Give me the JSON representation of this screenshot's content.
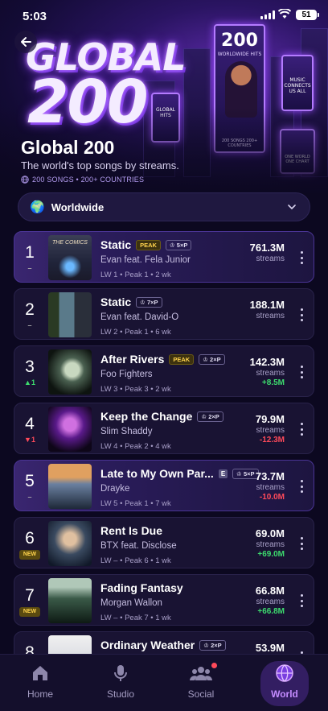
{
  "status_bar": {
    "time": "5:03",
    "battery": "51"
  },
  "hero": {
    "title_line1": "GLOBAL",
    "title_line2": "200",
    "billboard_main_big": "200",
    "billboard_main_small": "WORLDWIDE HITS",
    "billboard_main_foot": "200 SONGS 200+ COUNTRIES",
    "billboard_a": "GLOBAL HITS",
    "billboard_b": "MUSIC CONNECTS US ALL",
    "billboard_c": "ONE WORLD ONE CHART"
  },
  "header": {
    "title": "Global 200",
    "subtitle": "The world's top songs by streams.",
    "meta": "200 SONGS • 200+ COUNTRIES"
  },
  "region": {
    "label": "Worldwide",
    "icon": "globe-icon"
  },
  "rows": [
    {
      "rank": "1",
      "move": "–",
      "move_type": "same",
      "title": "Static",
      "peak_badge": "PEAK",
      "cert": "5×P",
      "explicit": "",
      "artist": "Evan feat. Fela Junior",
      "stats": "LW 1  •  Peak 1  •  2 wk",
      "streams": "761.3M",
      "unit": "streams",
      "delta": "",
      "delta_type": "",
      "highlight": true
    },
    {
      "rank": "2",
      "move": "–",
      "move_type": "same",
      "title": "Static",
      "peak_badge": "",
      "cert": "7×P",
      "explicit": "",
      "artist": "Evan feat. David-O",
      "stats": "LW 2  •  Peak 1  •  6 wk",
      "streams": "188.1M",
      "unit": "streams",
      "delta": "",
      "delta_type": "",
      "highlight": false
    },
    {
      "rank": "3",
      "move": "▲1",
      "move_type": "up",
      "title": "After Rivers",
      "peak_badge": "PEAK",
      "cert": "2×P",
      "explicit": "",
      "artist": "Foo Fighters",
      "stats": "LW 3  •  Peak 3  •  2 wk",
      "streams": "142.3M",
      "unit": "streams",
      "delta": "+8.5M",
      "delta_type": "pos",
      "highlight": false
    },
    {
      "rank": "4",
      "move": "▼1",
      "move_type": "down",
      "title": "Keep the Change",
      "peak_badge": "",
      "cert": "2×P",
      "explicit": "",
      "artist": "Slim Shaddy",
      "stats": "LW 4  •  Peak 2  •  4 wk",
      "streams": "79.9M",
      "unit": "streams",
      "delta": "-12.3M",
      "delta_type": "neg",
      "highlight": false
    },
    {
      "rank": "5",
      "move": "–",
      "move_type": "same",
      "title": "Late to My Own Par...",
      "peak_badge": "",
      "cert": "5×P",
      "explicit": "E",
      "artist": "Drayke",
      "stats": "LW 5  •  Peak 1  •  7 wk",
      "streams": "73.7M",
      "unit": "streams",
      "delta": "-10.0M",
      "delta_type": "neg",
      "highlight": true
    },
    {
      "rank": "6",
      "move": "NEW",
      "move_type": "new",
      "title": "Rent Is Due",
      "peak_badge": "",
      "cert": "",
      "explicit": "",
      "artist": "BTX feat. Disclose",
      "stats": "LW –  •  Peak 6  •  1 wk",
      "streams": "69.0M",
      "unit": "streams",
      "delta": "+69.0M",
      "delta_type": "pos",
      "highlight": false
    },
    {
      "rank": "7",
      "move": "NEW",
      "move_type": "new",
      "title": "Fading Fantasy",
      "peak_badge": "",
      "cert": "",
      "explicit": "",
      "artist": "Morgan Wallon",
      "stats": "LW –  •  Peak 7  •  1 wk",
      "streams": "66.8M",
      "unit": "streams",
      "delta": "+66.8M",
      "delta_type": "pos",
      "highlight": false
    },
    {
      "rank": "8",
      "move": "",
      "move_type": "same",
      "title": "Ordinary Weather",
      "peak_badge": "",
      "cert": "2×P",
      "explicit": "",
      "artist": "",
      "stats": "",
      "streams": "53.9M",
      "unit": "",
      "delta": "",
      "delta_type": "",
      "highlight": false
    }
  ],
  "art_text_1": "THE COMICS",
  "nav": {
    "home": "Home",
    "studio": "Studio",
    "social": "Social",
    "world": "World",
    "active": "world"
  }
}
